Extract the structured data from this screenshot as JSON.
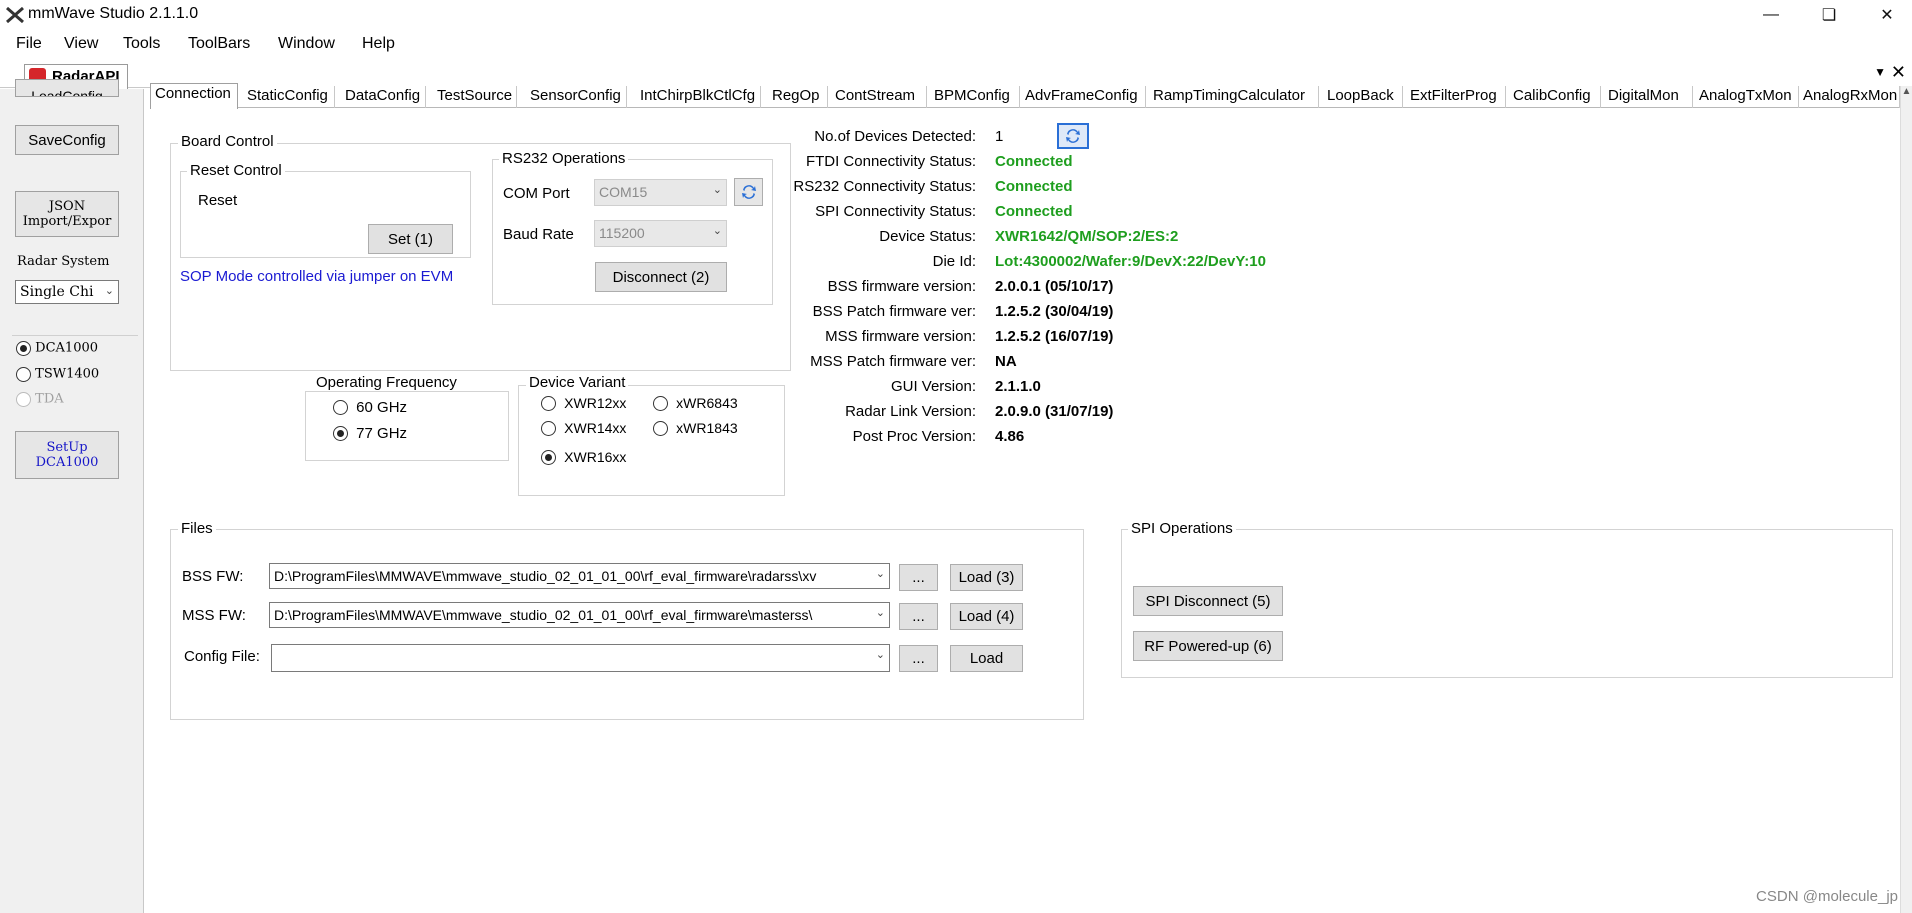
{
  "window": {
    "title": "mmWave Studio 2.1.1.0"
  },
  "menu": [
    "File",
    "View",
    "Tools",
    "ToolBars",
    "Window",
    "Help"
  ],
  "doc_tab": {
    "label": "RadarAPI"
  },
  "left_panel": {
    "load_config_partial": "LoadConfig",
    "save_config": "SaveConfig",
    "json_import": "JSON\nImport/Expor",
    "radar_system_label": "Radar System",
    "radar_system_value": "Single Chi",
    "radios": [
      {
        "label": "DCA1000",
        "checked": true,
        "disabled": false
      },
      {
        "label": "TSW1400",
        "checked": false,
        "disabled": false
      },
      {
        "label": "TDA",
        "checked": false,
        "disabled": true
      }
    ],
    "setup_button": "SetUp\nDCA1000"
  },
  "tabs": [
    "Connection",
    "StaticConfig",
    "DataConfig",
    "TestSource",
    "SensorConfig",
    "IntChirpBlkCtlCfg",
    "RegOp",
    "ContStream",
    "BPMConfig",
    "AdvFrameConfig",
    "RampTimingCalculator",
    "LoopBack",
    "ExtFilterProg",
    "CalibConfig",
    "DigitalMon",
    "AnalogTxMon",
    "AnalogRxMon"
  ],
  "board_control": {
    "title": "Board Control",
    "reset_group": "Reset Control",
    "reset_label": "Reset",
    "set_button": "Set (1)",
    "sop_note": "SOP Mode controlled via jumper on EVM"
  },
  "rs232": {
    "title": "RS232 Operations",
    "com_port_label": "COM Port",
    "com_port_value": "COM15",
    "baud_label": "Baud Rate",
    "baud_value": "115200",
    "disconnect_button": "Disconnect (2)"
  },
  "operating_frequency": {
    "title": "Operating Frequency",
    "options": [
      {
        "label": "60 GHz",
        "checked": false
      },
      {
        "label": "77 GHz",
        "checked": true
      }
    ]
  },
  "device_variant": {
    "title": "Device Variant",
    "options": [
      {
        "label": "XWR12xx",
        "checked": false
      },
      {
        "label": "xWR6843",
        "checked": false
      },
      {
        "label": "XWR14xx",
        "checked": false
      },
      {
        "label": "xWR1843",
        "checked": false
      },
      {
        "label": "XWR16xx",
        "checked": true
      }
    ]
  },
  "status": [
    {
      "label": "No.of Devices Detected:",
      "value": "1",
      "color": "#000000"
    },
    {
      "label": "FTDI Connectivity Status:",
      "value": "Connected",
      "color": "#1e9e1e"
    },
    {
      "label": "RS232 Connectivity Status:",
      "value": "Connected",
      "color": "#1e9e1e"
    },
    {
      "label": "SPI Connectivity Status:",
      "value": "Connected",
      "color": "#1e9e1e"
    },
    {
      "label": "Device Status:",
      "value": "XWR1642/QM/SOP:2/ES:2",
      "color": "#1e9e1e"
    },
    {
      "label": "Die Id:",
      "value": "Lot:4300002/Wafer:9/DevX:22/DevY:10",
      "color": "#1e9e1e"
    },
    {
      "label": "BSS firmware version:",
      "value": "2.0.0.1 (05/10/17)",
      "color": "#000000"
    },
    {
      "label": "BSS Patch firmware ver:",
      "value": "1.2.5.2 (30/04/19)",
      "color": "#000000"
    },
    {
      "label": "MSS firmware version:",
      "value": "1.2.5.2 (16/07/19)",
      "color": "#000000"
    },
    {
      "label": "MSS Patch firmware ver:",
      "value": "NA",
      "color": "#000000"
    },
    {
      "label": "GUI Version:",
      "value": "2.1.1.0",
      "color": "#000000"
    },
    {
      "label": "Radar Link Version:",
      "value": "2.0.9.0 (31/07/19)",
      "color": "#000000"
    },
    {
      "label": "Post Proc Version:",
      "value": "4.86",
      "color": "#000000"
    }
  ],
  "files": {
    "title": "Files",
    "rows": [
      {
        "label": "BSS FW:",
        "value": "D:\\ProgramFiles\\MMWAVE\\mmwave_studio_02_01_01_00\\rf_eval_firmware\\radarss\\xv",
        "browse": "...",
        "load": "Load (3)"
      },
      {
        "label": "MSS FW:",
        "value": "D:\\ProgramFiles\\MMWAVE\\mmwave_studio_02_01_01_00\\rf_eval_firmware\\masterss\\",
        "browse": "...",
        "load": "Load (4)"
      },
      {
        "label": "Config File:",
        "value": "",
        "browse": "...",
        "load": "Load"
      }
    ]
  },
  "spi": {
    "title": "SPI Operations",
    "disconnect_button": "SPI Disconnect (5)",
    "rf_button": "RF Powered-up (6)"
  },
  "watermark": "CSDN @molecule_jp"
}
